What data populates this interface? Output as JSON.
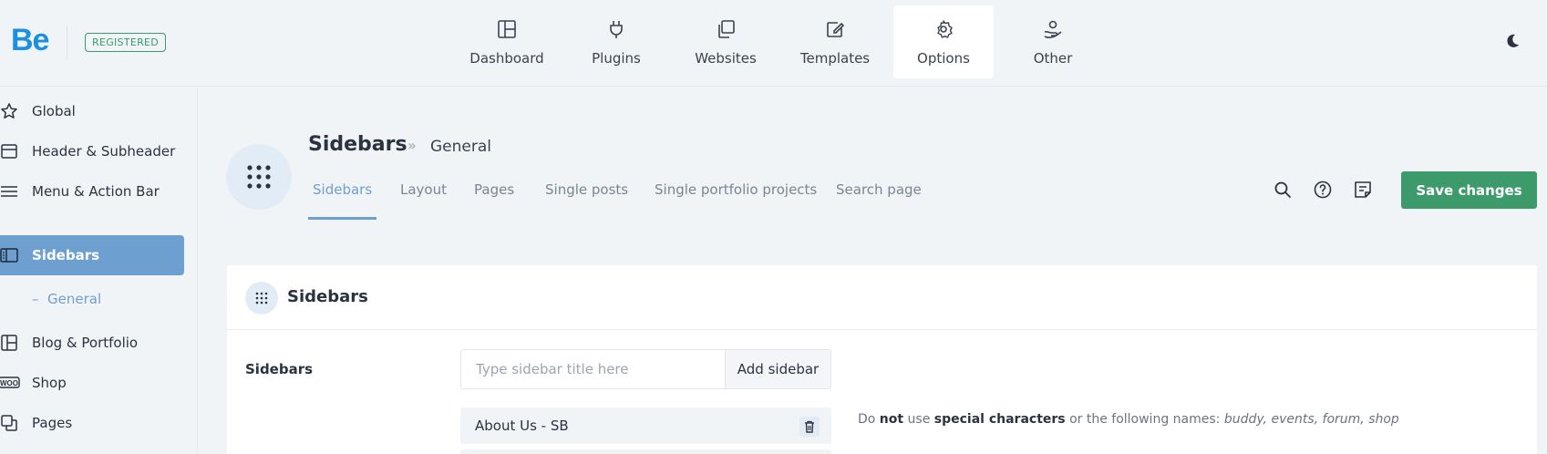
{
  "brand": {
    "logo_text": "Be",
    "badge": "REGISTERED",
    "accent": "#1b8fe3",
    "badge_color": "#3a9a6a"
  },
  "topnav": {
    "items": [
      {
        "label": "Dashboard",
        "icon": "dashboard-grid-icon"
      },
      {
        "label": "Plugins",
        "icon": "plug-icon"
      },
      {
        "label": "Websites",
        "icon": "copies-icon"
      },
      {
        "label": "Templates",
        "icon": "template-edit-icon"
      },
      {
        "label": "Options",
        "icon": "gear-icon",
        "active": true
      },
      {
        "label": "Other",
        "icon": "hand-user-icon"
      }
    ],
    "theme_toggle_icon": "moon-icon"
  },
  "sidebar": {
    "items": [
      {
        "label": "Global",
        "icon": "star-icon"
      },
      {
        "label": "Header & Subheader",
        "icon": "header-layout-icon"
      },
      {
        "label": "Menu & Action Bar",
        "icon": "menu-lines-icon"
      },
      {
        "label": "Sidebars",
        "icon": "sidebar-layout-icon",
        "active": true
      },
      {
        "label": "Blog & Portfolio",
        "icon": "blog-layout-icon"
      },
      {
        "label": "Shop",
        "icon": "woo-icon"
      },
      {
        "label": "Pages",
        "icon": "pages-icon"
      }
    ],
    "subitem": {
      "dash": "–",
      "label": "General"
    },
    "active_color": "#6e9fd1"
  },
  "header": {
    "title": "Sidebars",
    "separator": "»",
    "crumb": "General",
    "tabs": [
      {
        "label": "Sidebars",
        "active": true
      },
      {
        "label": "Layout"
      },
      {
        "label": "Pages"
      },
      {
        "label": "Single posts"
      },
      {
        "label": "Single portfolio projects"
      },
      {
        "label": "Search page"
      }
    ],
    "tools": [
      "search-icon",
      "help-circle-icon",
      "notes-icon"
    ],
    "save_label": "Save changes",
    "save_color": "#3d9a6b"
  },
  "card": {
    "title": "Sidebars",
    "row_label": "Sidebars",
    "input_placeholder": "Type sidebar title here",
    "input_value": "",
    "add_label": "Add sidebar",
    "sidebars": [
      {
        "label": "About Us - SB"
      }
    ],
    "help": {
      "p1": "Do ",
      "b1": "not",
      "p2": " use ",
      "b2": "special characters",
      "p3": " or the following names: ",
      "names": "buddy, events, forum, shop"
    }
  }
}
